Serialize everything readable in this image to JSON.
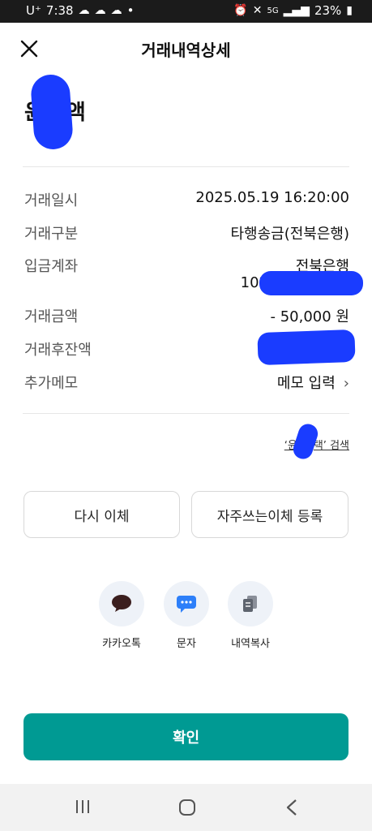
{
  "status_bar": {
    "carrier": "U⁺",
    "time": "7:38",
    "dot": "•",
    "network": "5G",
    "battery": "23%"
  },
  "header": {
    "title": "거래내역상세",
    "close_icon": "close-icon"
  },
  "account": {
    "name_visible_start": "윤",
    "name_visible_end": "액"
  },
  "details": {
    "rows": [
      {
        "label": "거래일시",
        "value": "2025.05.19 16:20:00"
      },
      {
        "label": "거래구분",
        "value": "타행송금(전북은행)"
      },
      {
        "label": "입금계좌",
        "value": "전북은행",
        "sub_value": "102"
      },
      {
        "label": "거래금액",
        "value": "- 50,000 원"
      },
      {
        "label": "거래후잔액",
        "value": ""
      },
      {
        "label": "추가메모",
        "value": "메모 입력"
      }
    ]
  },
  "search_link": {
    "open_quote": "‘윤",
    "close_quote": "택’ 검색"
  },
  "actions": {
    "retransfer": "다시 이체",
    "favorite": "자주쓰는이체 등록"
  },
  "share": [
    {
      "label": "카카오톡",
      "icon": "kakao-talk-icon"
    },
    {
      "label": "문자",
      "icon": "sms-icon"
    },
    {
      "label": "내역복사",
      "icon": "copy-icon"
    }
  ],
  "confirm_label": "확인",
  "colors": {
    "accent": "#009a93",
    "redaction": "#1a3cff"
  }
}
